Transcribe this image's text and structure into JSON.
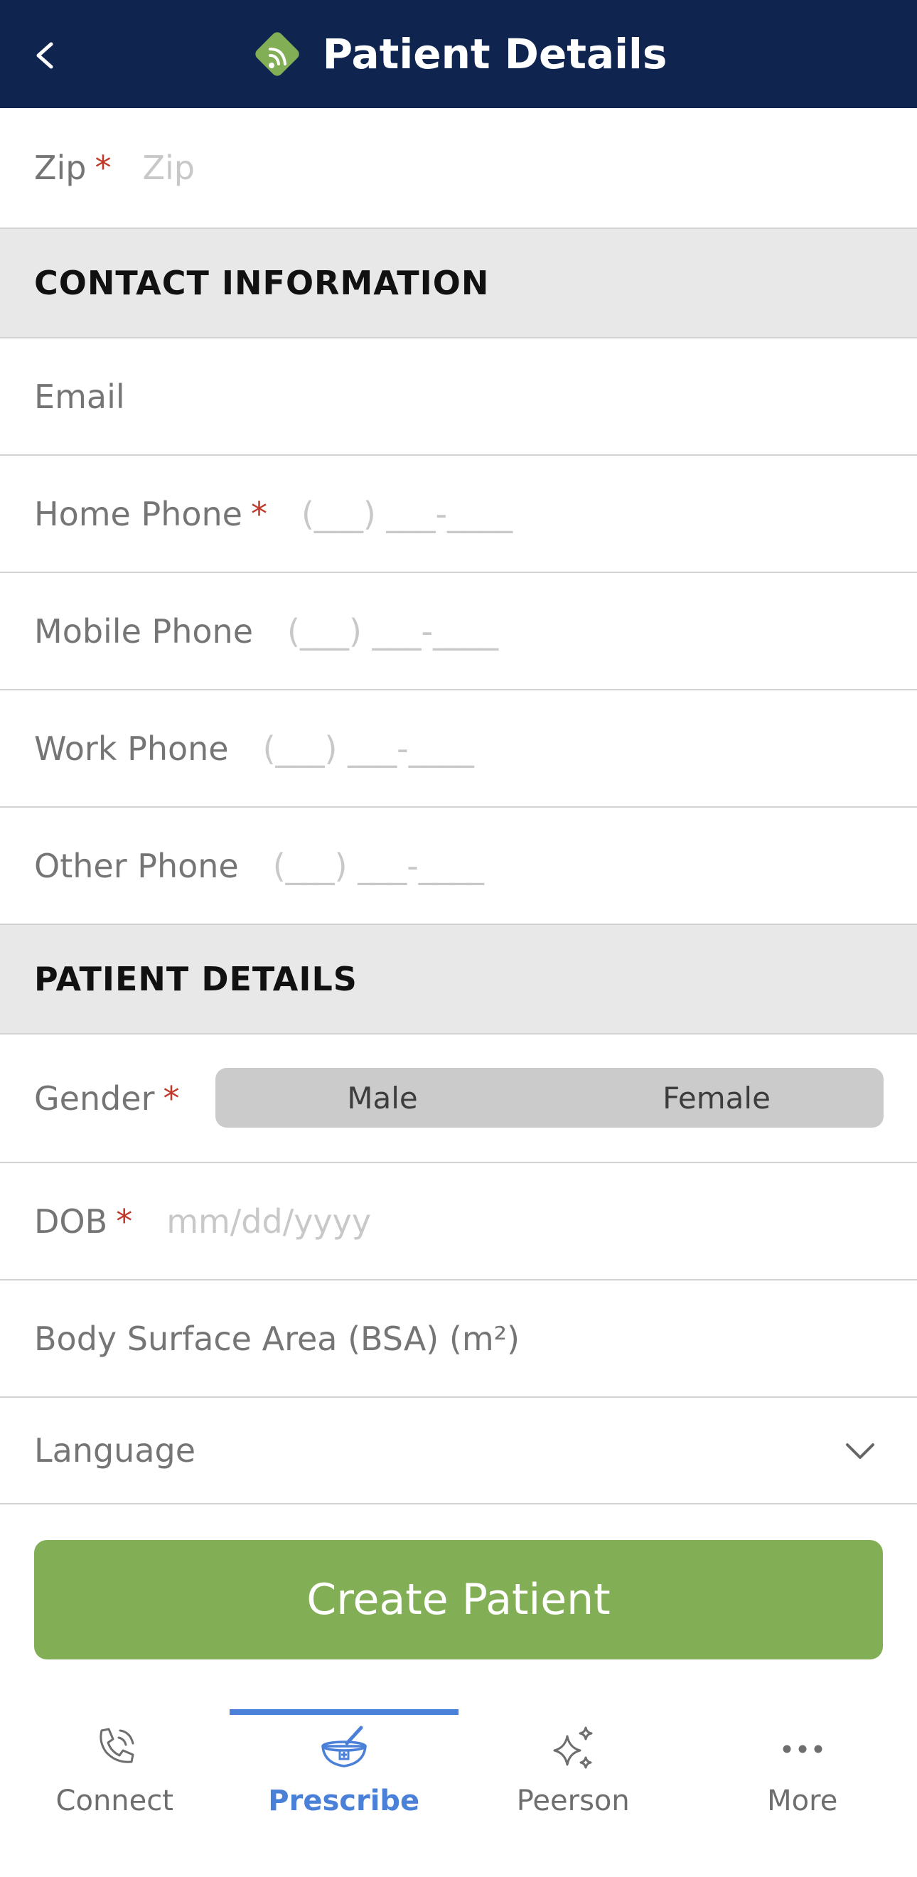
{
  "header": {
    "title": "Patient Details"
  },
  "address": {
    "zip_label": "Zip",
    "zip_placeholder": "Zip"
  },
  "sections": {
    "contact": "CONTACT INFORMATION",
    "patient": "PATIENT DETAILS"
  },
  "contact": {
    "email_label": "Email",
    "home_phone_label": "Home Phone",
    "home_phone_placeholder": "(___) ___-____",
    "mobile_phone_label": "Mobile Phone",
    "mobile_phone_placeholder": "(___) ___-____",
    "work_phone_label": "Work Phone",
    "work_phone_placeholder": "(___) ___-____",
    "other_phone_label": "Other Phone",
    "other_phone_placeholder": "(___) ___-____"
  },
  "patient": {
    "gender_label": "Gender",
    "gender_options": [
      "Male",
      "Female"
    ],
    "dob_label": "DOB",
    "dob_placeholder": "mm/dd/yyyy",
    "bsa_label": "Body Surface Area (BSA) (m²)",
    "language_label": "Language"
  },
  "required_marker": "*",
  "cta": {
    "label": "Create Patient"
  },
  "tabbar": {
    "items": [
      {
        "label": "Connect",
        "icon": "phone-icon"
      },
      {
        "label": "Prescribe",
        "icon": "mortar-pestle-icon"
      },
      {
        "label": "Peerson",
        "icon": "sparkle-icon"
      },
      {
        "label": "More",
        "icon": "more-dots-icon"
      }
    ],
    "active_index": 1
  },
  "colors": {
    "header": "#0f2550",
    "accent_green": "#82af55",
    "active_tab": "#4a80d8",
    "required": "#c0392b"
  }
}
